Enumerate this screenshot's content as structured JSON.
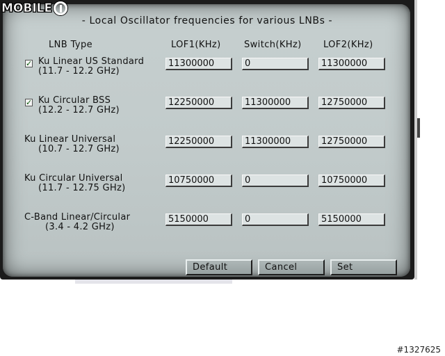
{
  "logo": {
    "text": "MOBILE"
  },
  "dialog": {
    "title": "- Local Oscillator frequencies for various LNBs -",
    "headers": {
      "lnb_type": "LNB Type",
      "lof1": "LOF1(KHz)",
      "switch": "Switch(KHz)",
      "lof2": "LOF2(KHz)"
    },
    "rows": [
      {
        "name": "Ku Linear US Standard",
        "range": "(11.7 - 12.2 GHz)",
        "checked": true,
        "lof1": "11300000",
        "switch": "0",
        "lof2": "11300000"
      },
      {
        "name": "Ku Circular BSS",
        "range": "(12.2 - 12.7 GHz)",
        "checked": true,
        "lof1": "12250000",
        "switch": "11300000",
        "lof2": "12750000"
      },
      {
        "name": "Ku Linear Universal",
        "range": "(10.7 - 12.7 GHz)",
        "checked": false,
        "lof1": "12250000",
        "switch": "11300000",
        "lof2": "12750000"
      },
      {
        "name": "Ku Circular Universal",
        "range": "(11.7 - 12.75 GHz)",
        "checked": false,
        "lof1": "10750000",
        "switch": "0",
        "lof2": "10750000"
      },
      {
        "name": "C-Band Linear/Circular",
        "range": "(3.4 - 4.2 GHz)",
        "checked": false,
        "lof1": "5150000",
        "switch": "0",
        "lof2": "5150000"
      }
    ],
    "buttons": {
      "default": "Default",
      "cancel": "Cancel",
      "set": "Set"
    }
  },
  "footer": {
    "image_id": "#1327625"
  },
  "colors": {
    "frame": "#1b1b1b",
    "panel": "#c4cdcd",
    "check": "#0a5a0a"
  },
  "icons": {
    "checkbox_checked": "check-icon",
    "logo_mark": "power-icon"
  }
}
